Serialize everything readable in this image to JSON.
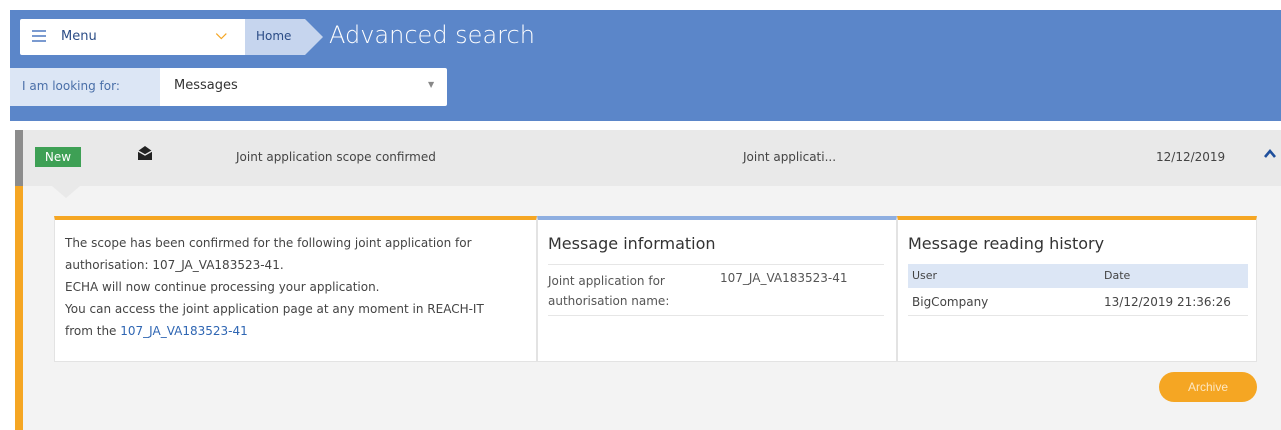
{
  "header": {
    "menu_label": "Menu",
    "breadcrumb_home": "Home",
    "page_title": "Advanced search",
    "looking_for_label": "I am looking for:",
    "looking_for_value": "Messages"
  },
  "message": {
    "badge": "New",
    "subject": "Joint application scope confirmed",
    "category": "Joint applicati...",
    "date": "12/12/2019",
    "body_lines": [
      "The scope has been confirmed for the following joint application for",
      "authorisation: 107_JA_VA183523-41.",
      "ECHA will now continue processing your application.",
      "You can access the joint application page at any moment in REACH-IT"
    ],
    "body_link_prefix": "from the ",
    "body_link": "107_JA_VA183523-41"
  },
  "info": {
    "title": "Message information",
    "label": "Joint application for authorisation name:",
    "value": "107_JA_VA183523-41"
  },
  "history": {
    "title": "Message reading history",
    "col_user": "User",
    "col_date": "Date",
    "rows": [
      {
        "user": "BigCompany",
        "date": "13/12/2019 21:36:26"
      }
    ]
  },
  "actions": {
    "archive_label": "Archive"
  },
  "colors": {
    "header_bg": "#5b86c9",
    "accent_orange": "#f5a623",
    "badge_green": "#3ea055",
    "link_blue": "#2f66b3"
  }
}
